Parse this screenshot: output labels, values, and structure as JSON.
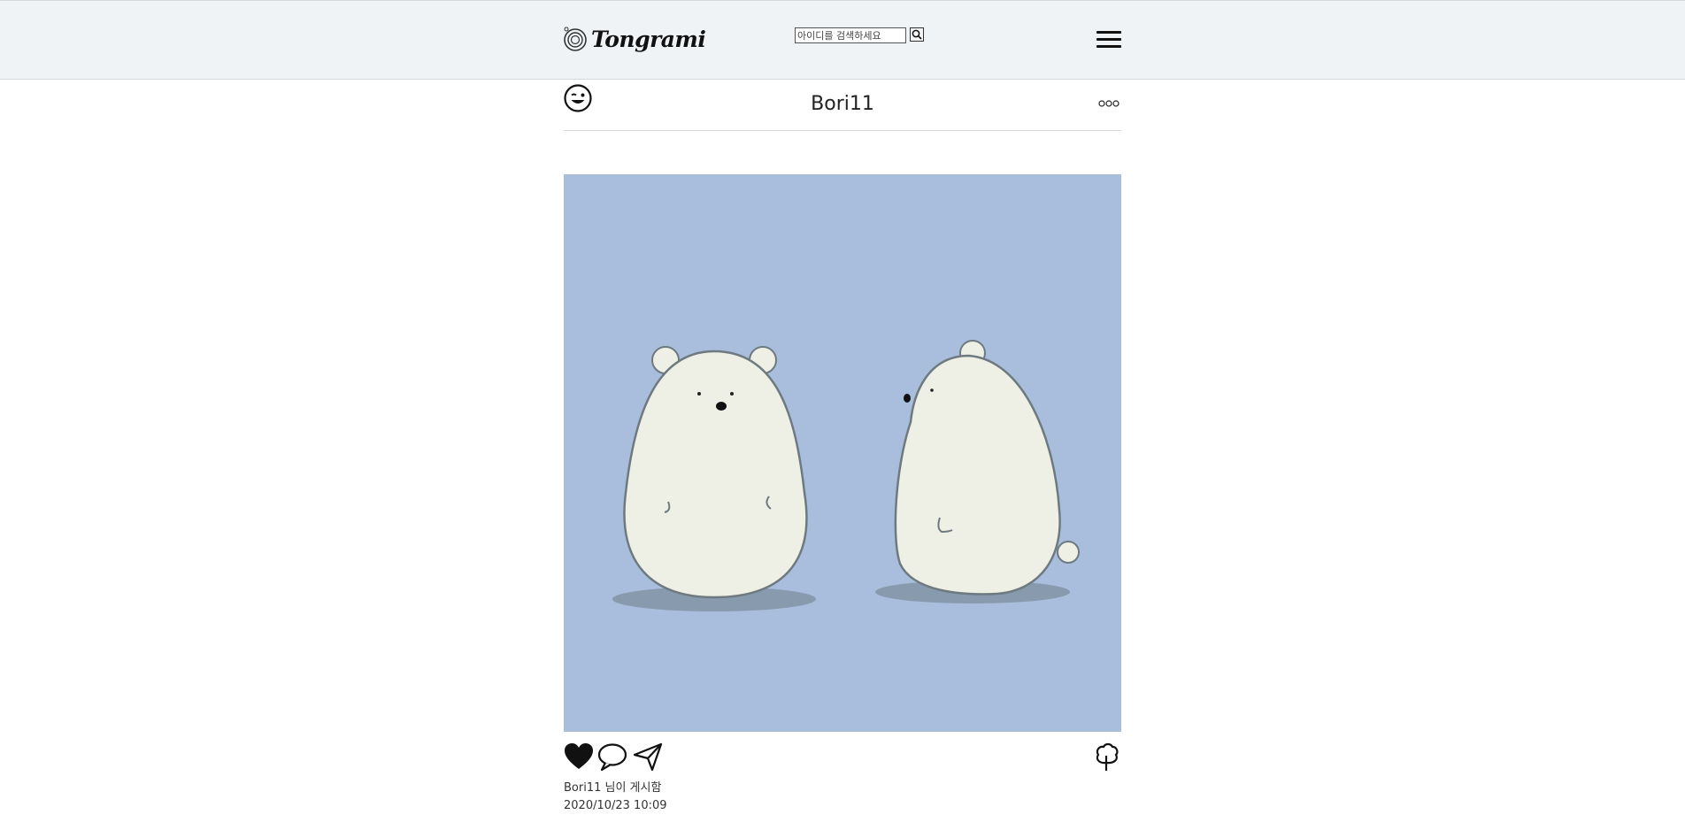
{
  "header": {
    "brand": "Tongrami",
    "search_placeholder": "아이디를 검색하세요",
    "menu_icon": "hamburger-menu-icon",
    "search_icon": "search-icon",
    "logo_icon": "camera-lens-icon"
  },
  "post": {
    "username": "Bori11",
    "avatar_icon": "winking-face-icon",
    "more_label": "ooo",
    "image_description_icon": "polar-bears-image",
    "image_background": "#a8bedc",
    "actions": [
      "heart-icon",
      "comment-icon",
      "share-icon",
      "tree-icon"
    ],
    "caption": "Bori11 님이 게시함",
    "datetime": "2020/10/23 10:09"
  }
}
